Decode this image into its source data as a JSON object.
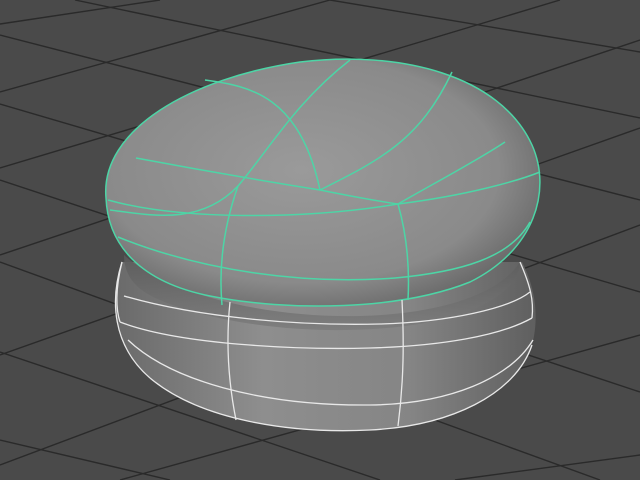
{
  "viewport": {
    "background": "#4a4a4a",
    "grid_color": "#2a2a2a",
    "object_fill": "#8c8c8c",
    "wire_selected": "#4dd5a6",
    "wire_unselected": "#e8e8e8"
  },
  "object": {
    "kind": "nurbs-surface",
    "selection": {
      "top-cap": "selected",
      "base-band": "unselected"
    }
  }
}
